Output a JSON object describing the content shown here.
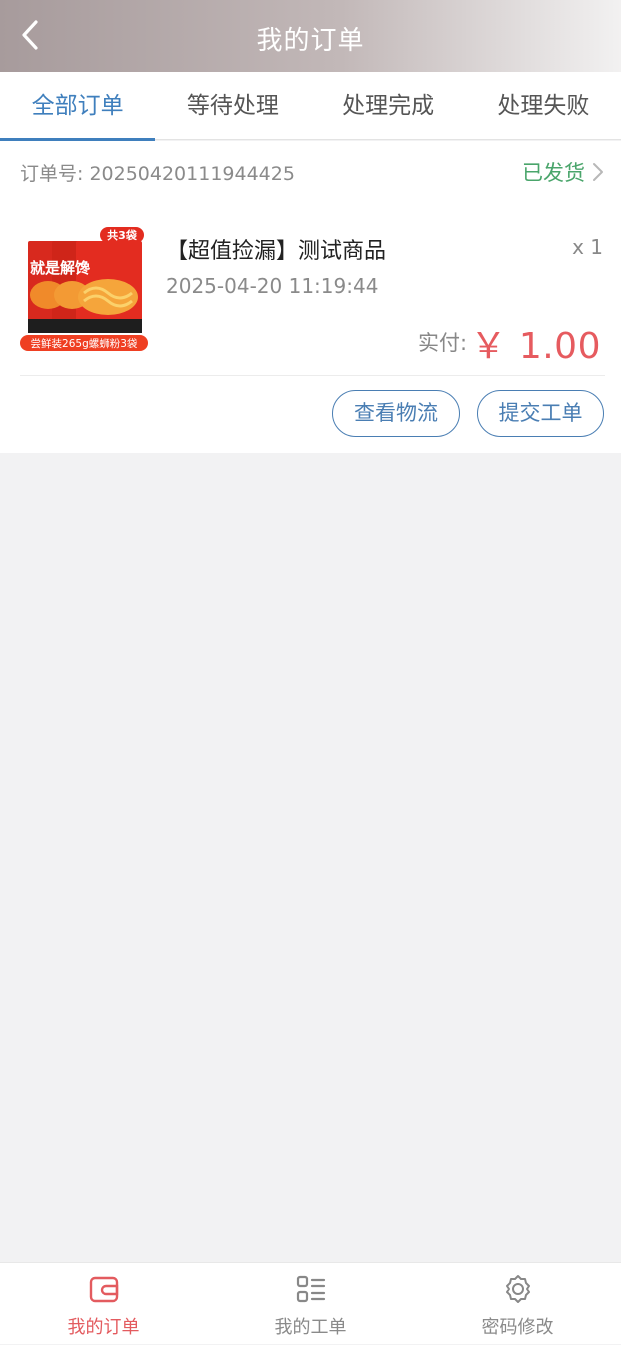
{
  "header": {
    "title": "我的订单"
  },
  "tabs": [
    "全部订单",
    "等待处理",
    "处理完成",
    "处理失败"
  ],
  "order": {
    "order_no_label": "订单号: 20250420111944425",
    "status": "已发货",
    "product": {
      "title": "【超值捡漏】测试商品",
      "quantity": "x 1",
      "date": "2025-04-20 11:19:44",
      "paid_label": "实付:",
      "price": "￥ 1.00",
      "image_text": {
        "badge": "共3袋",
        "name": "就是解馋",
        "caption": "尝鲜装265g螺蛳粉3袋"
      }
    },
    "buttons": {
      "logistics": "查看物流",
      "ticket": "提交工单"
    }
  },
  "bottom_nav": [
    {
      "label": "我的订单",
      "icon": "wallet-icon"
    },
    {
      "label": "我的工单",
      "icon": "list-icon"
    },
    {
      "label": "密码修改",
      "icon": "gear-icon"
    }
  ],
  "colors": {
    "accent": "#3f7fbd",
    "price": "#e65b5f",
    "status_green": "#4aa56b",
    "nav_active": "#e35b5f"
  }
}
